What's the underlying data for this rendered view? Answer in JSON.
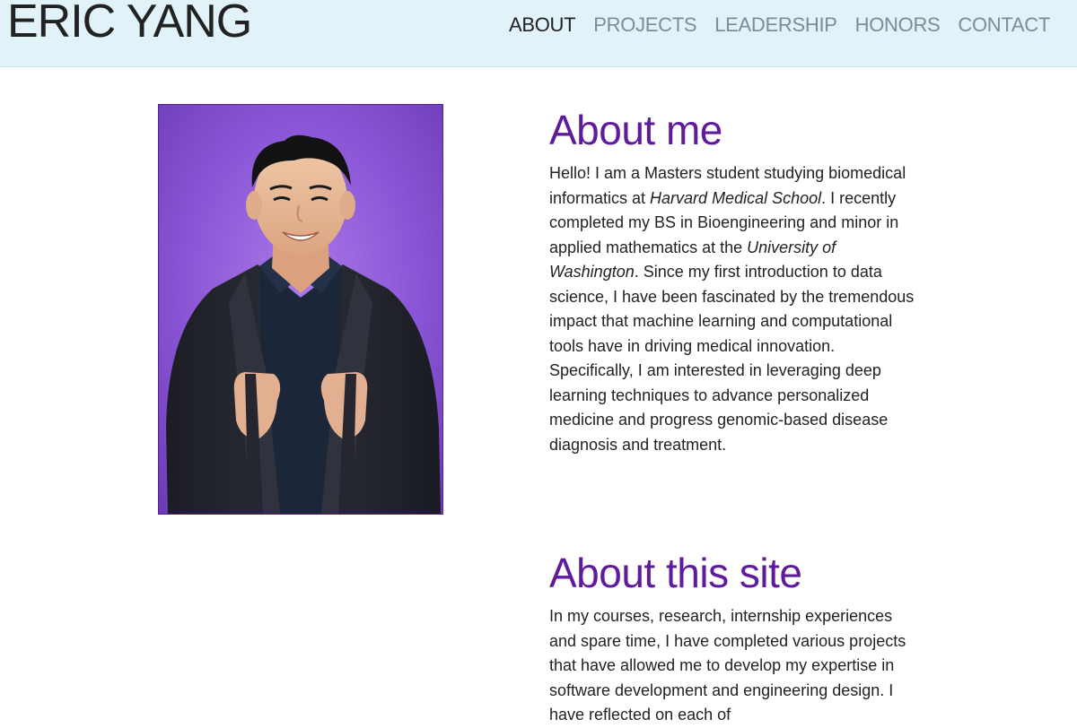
{
  "header": {
    "site_title": "ERIC YANG",
    "nav": [
      {
        "label": "ABOUT",
        "active": true
      },
      {
        "label": "PROJECTS",
        "active": false
      },
      {
        "label": "LEADERSHIP",
        "active": false
      },
      {
        "label": "HONORS",
        "active": false
      },
      {
        "label": "CONTACT",
        "active": false
      }
    ]
  },
  "about_me": {
    "title": "About me",
    "parts": [
      "Hello! I am a Masters student studying biomedical informatics at ",
      "Harvard Medical School",
      ". I recently completed my BS in Bioengineering and minor in applied mathematics at the ",
      "University of Washington",
      ". Since my first introduction to data science, I have been fascinated by the tremendous impact that machine learning and computational tools have in driving medical innovation. Specifically, I am interested in leveraging deep learning techniques to advance personalized medicine and progress genomic-based disease diagnosis and treatment."
    ]
  },
  "about_site": {
    "title": "About this site",
    "body": "In my courses, research, internship experiences and spare time, I have completed various projects that have allowed me to develop my expertise in software development and engineering design. I have reflected on each of"
  },
  "colors": {
    "header_bg": "#e1f3f9",
    "heading_purple": "#5f1b9c",
    "photo_bg": "#8a55d6",
    "nav_inactive": "#7f8b95",
    "nav_active": "#222222"
  }
}
